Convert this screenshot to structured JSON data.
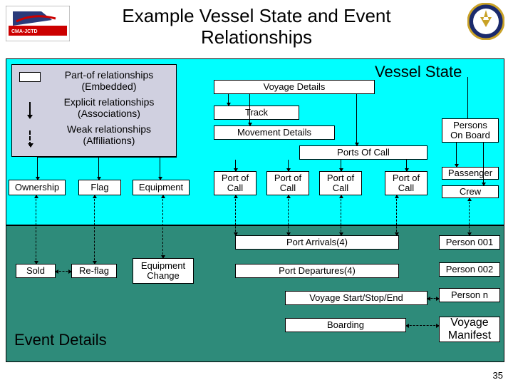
{
  "title": "Example Vessel State and Event Relationships",
  "legend": {
    "partof": "Part-of relationships\n(Embedded)",
    "explicit": "Explicit relationships\n(Associations)",
    "weak": "Weak relationships\n(Affiliations)"
  },
  "labels": {
    "vessel_state": "Vessel State",
    "voyage_details": "Voyage Details",
    "track": "Track",
    "movement_details": "Movement Details",
    "ports_of_call": "Ports Of Call",
    "persons_on_board": "Persons\nOn Board",
    "passenger": "Passenger",
    "crew": "Crew",
    "ownership": "Ownership",
    "flag": "Flag",
    "equipment": "Equipment",
    "port_of_call": "Port of\nCall",
    "port_arrivals": "Port Arrivals(4)",
    "port_departures": "Port Departures(4)",
    "voyage_sse": "Voyage Start/Stop/End",
    "boarding": "Boarding",
    "sold": "Sold",
    "reflag": "Re-flag",
    "equipment_change": "Equipment\nChange",
    "event_details": "Event Details",
    "person_001": "Person 001",
    "person_002": "Person 002",
    "person_n": "Person n",
    "voyage_manifest": "Voyage\nManifest"
  },
  "page_number": "35"
}
